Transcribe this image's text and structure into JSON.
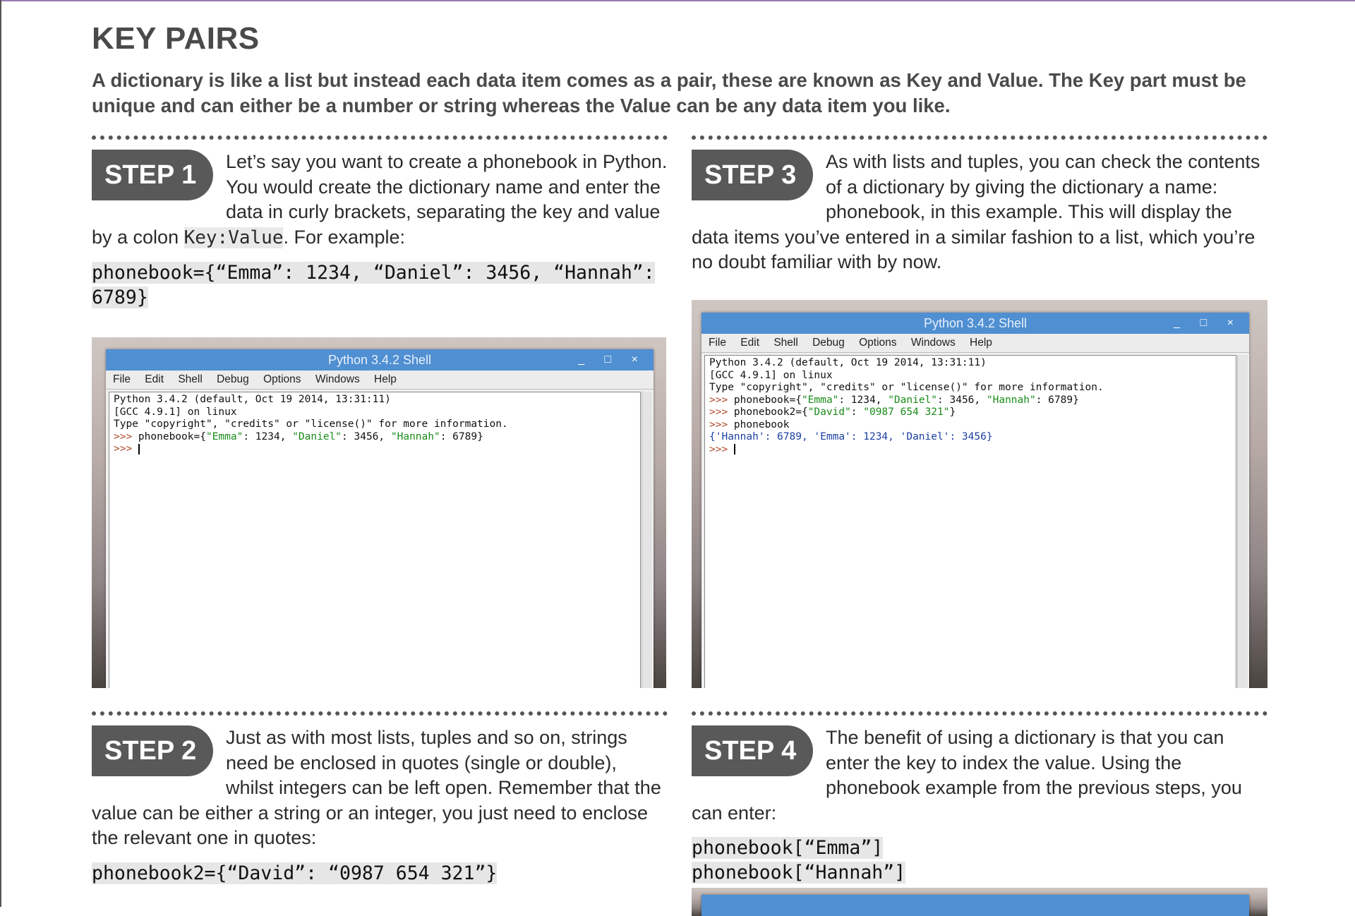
{
  "page": {
    "title": "KEY PAIRS",
    "intro": "A dictionary is like a list but instead each data item comes as a pair, these are known as Key and Value. The Key part must be unique and can either be a number or string whereas the Value can be any data item you like."
  },
  "steps": [
    {
      "badge": "STEP 1",
      "text_a": "Let’s say you want to create a phonebook in Python. You would create the dictionary name and enter the data in curly brackets, separating the key and value by a colon ",
      "inline_code": "Key:Value",
      "text_b": ". For example:",
      "code": [
        "phonebook={“Emma”: 1234, “Daniel”: 3456, “Hannah”:",
        "6789}"
      ]
    },
    {
      "badge": "STEP 2",
      "text_a": "Just as with most lists, tuples and so on, strings need be enclosed in quotes (single or double), whilst integers can be left open. Remember that the value can be either a string or an integer, you just need to enclose the relevant one in quotes:",
      "code": [
        "phonebook2={“David”: “0987 654 321”}"
      ]
    },
    {
      "badge": "STEP 3",
      "text_a": "As with lists and tuples, you can check the contents of a dictionary by giving the dictionary a name: phonebook, in this example. This will display the data items you’ve entered in a similar fashion to a list, which you’re no doubt familiar with by now."
    },
    {
      "badge": "STEP 4",
      "text_a": "The benefit of using a dictionary is that you can enter the key to index the value. Using the phonebook example from the previous steps, you can enter:",
      "code": [
        "phonebook[“Emma”]",
        "phonebook[“Hannah”]"
      ]
    }
  ],
  "shell": {
    "title": "Python 3.4.2 Shell",
    "buttons": "_ □ ×",
    "menu": [
      "File",
      "Edit",
      "Shell",
      "Debug",
      "Options",
      "Windows",
      "Help"
    ],
    "banner": [
      "Python 3.4.2 (default, Oct 19 2014, 13:31:11)",
      "[GCC 4.9.1] on linux",
      "Type \"copyright\", \"credits\" or \"license()\" for more information."
    ],
    "prompt": ">>> ",
    "cmd1": {
      "a": "phonebook={",
      "s1": "\"Emma\"",
      "b": ": 1234, ",
      "s2": "\"Daniel\"",
      "c": ": 3456, ",
      "s3": "\"Hannah\"",
      "d": ": 6789}"
    },
    "cmd2": {
      "a": "phonebook2={",
      "s1": "\"David\"",
      "b": ": ",
      "s2": "\"0987 654 321\"",
      "c": "}"
    },
    "cmd3": "phonebook",
    "output": "{'Hannah': 6789, 'Emma': 1234, 'Daniel': 3456}"
  },
  "colors": {
    "badge": "#595959",
    "titlebar": "#4f8fd2",
    "string": "#1a8a1a",
    "output": "#1b3fa0"
  }
}
